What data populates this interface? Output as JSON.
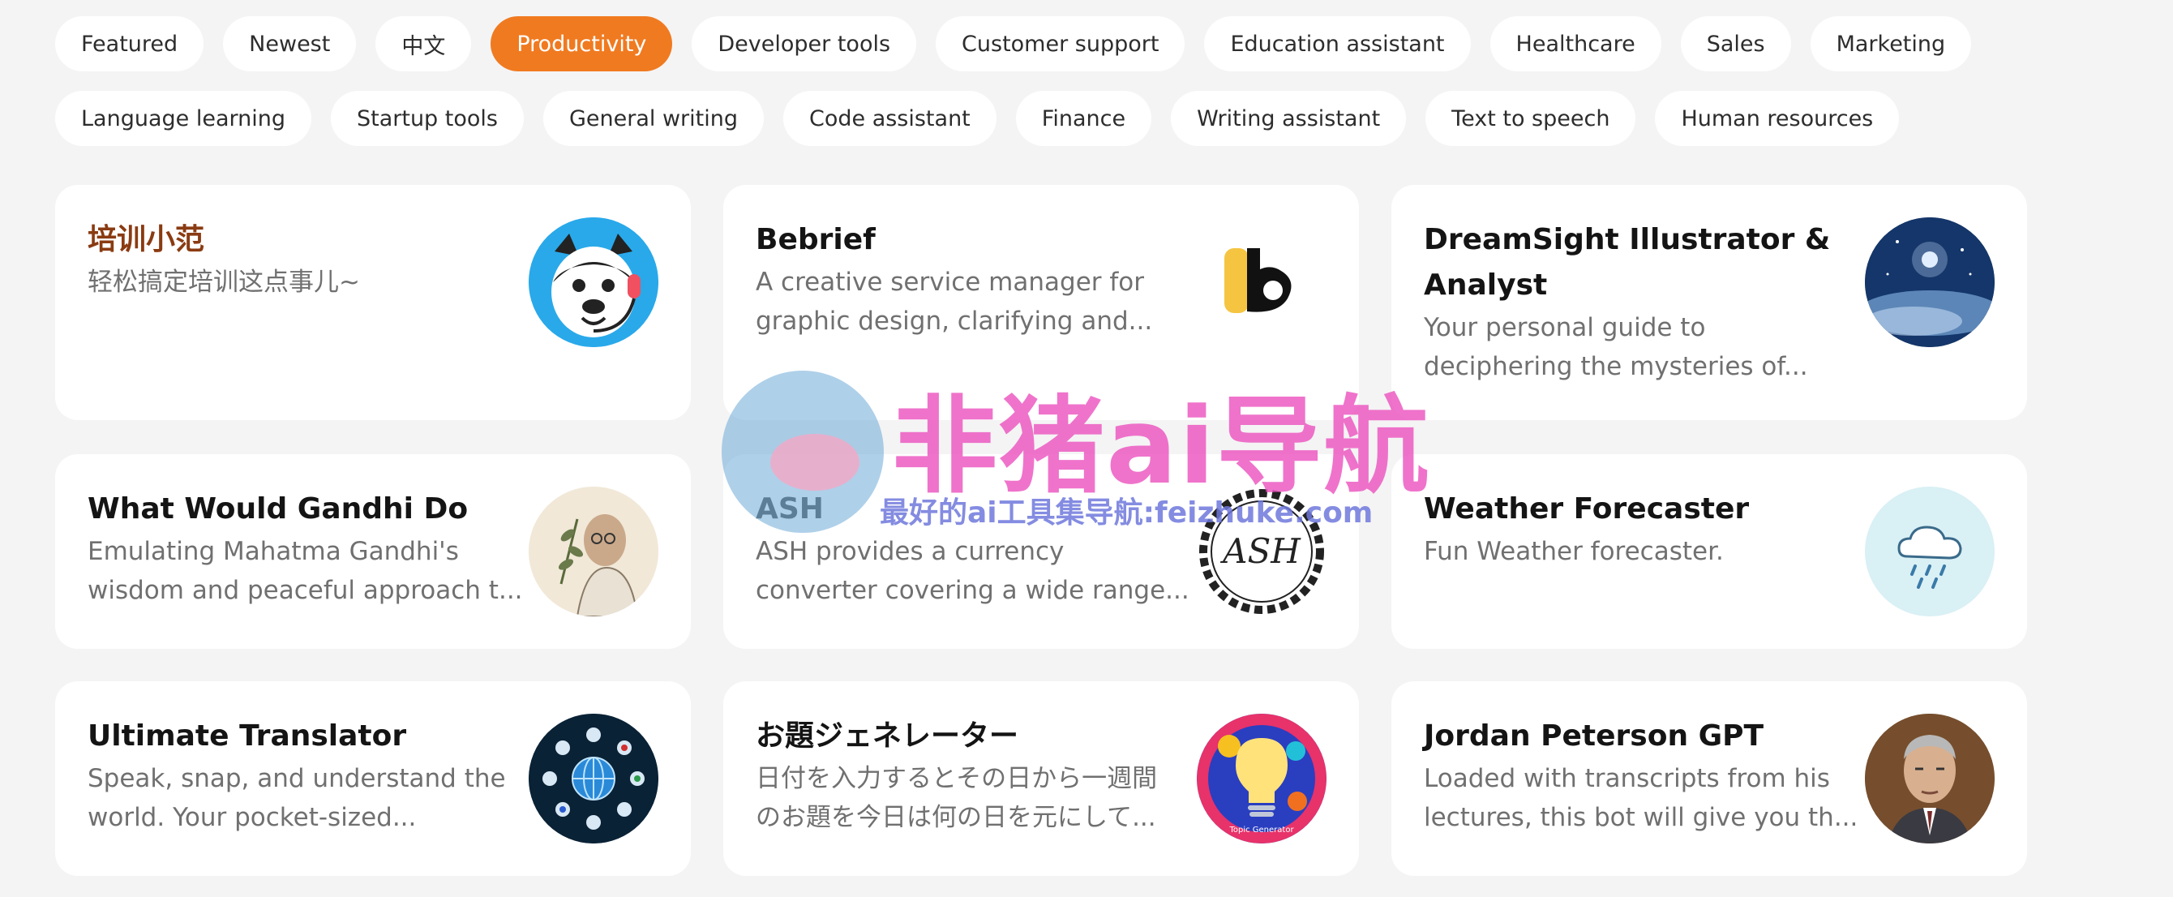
{
  "categories": {
    "row1": [
      "Featured",
      "Newest",
      "中文",
      "Productivity",
      "Developer tools",
      "Customer support",
      "Education assistant",
      "Healthcare",
      "Sales",
      "Marketing"
    ],
    "row2": [
      "Language learning",
      "Startup tools",
      "General writing",
      "Code assistant",
      "Finance",
      "Writing assistant",
      "Text to speech",
      "Human resources"
    ],
    "active": "Productivity"
  },
  "cards": [
    {
      "title": "培训小范",
      "desc": [
        "轻松搞定培训这点事儿~"
      ],
      "icon": "husky-headset-icon"
    },
    {
      "title": "Bebrief",
      "desc": [
        "A creative service manager for",
        "graphic design, clarifying and..."
      ],
      "icon": "letter-b-logo-icon"
    },
    {
      "title": [
        "DreamSight Illustrator &",
        "Analyst"
      ],
      "desc": [
        "Your personal guide to",
        "deciphering the mysteries of..."
      ],
      "icon": "night-sky-moon-icon"
    },
    {
      "title": "What Would Gandhi Do",
      "desc": [
        "Emulating Mahatma Gandhi's",
        "wisdom and peaceful approach t..."
      ],
      "icon": "gandhi-portrait-icon"
    },
    {
      "title": "ASH",
      "desc": [
        "ASH provides a currency",
        "converter covering a wide range..."
      ],
      "icon": "ash-gear-logo-icon",
      "icon_text": "ASH"
    },
    {
      "title": "Weather Forecaster",
      "desc": [
        "Fun Weather forecaster."
      ],
      "icon": "rain-cloud-icon"
    },
    {
      "title": "Ultimate Translator",
      "desc": [
        "Speak, snap, and understand the",
        "world. Your pocket-sized..."
      ],
      "icon": "globe-flags-icon"
    },
    {
      "title": "お題ジェネレーター",
      "desc": [
        "日付を入力するとその日から一週間",
        "のお題を今日は何の日を元にして..."
      ],
      "icon": "lightbulb-topic-generator-icon",
      "icon_text": "Topic Generator"
    },
    {
      "title": "Jordan Peterson GPT",
      "desc": [
        "Loaded with transcripts from his",
        "lectures, this bot will give you th..."
      ],
      "icon": "jordan-peterson-portrait-icon"
    }
  ],
  "watermark": {
    "title": "非猪ai导航",
    "subtitle": "最好的ai工具集导航:feizhuke.com"
  },
  "colors": {
    "accent": "#f07a20",
    "page_bg": "#f4f4f4",
    "card_bg": "#ffffff",
    "chinese_title": "#8a3b12"
  }
}
